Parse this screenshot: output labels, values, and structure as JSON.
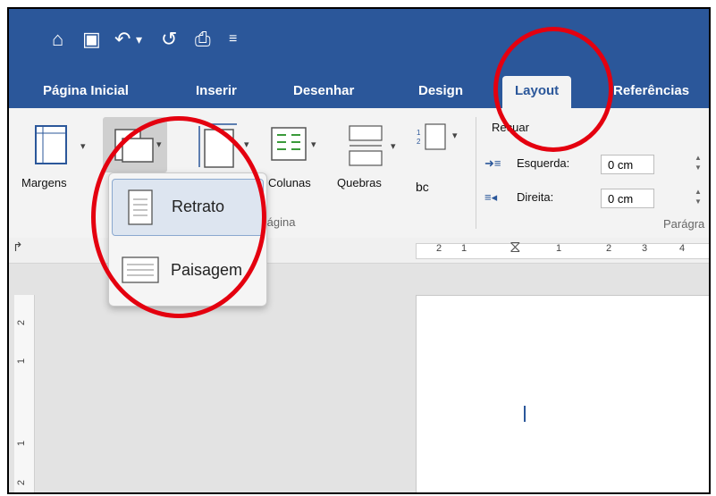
{
  "tabs": [
    "Página Inicial",
    "Inserir",
    "Desenhar",
    "Design",
    "Layout",
    "Referências"
  ],
  "active_tab": "Layout",
  "ribbon": {
    "margens_label": "Margens",
    "colunas_label": "Colunas",
    "quebras_label": "Quebras",
    "hyphen_label": "bc",
    "recuar_label": "Recuar",
    "esquerda_label": "Esquerda:",
    "direita_label": "Direita:",
    "esquerda_value": "0 cm",
    "direita_value": "0 cm",
    "pagina_group": "Página",
    "paragrafo_group": "Parágra"
  },
  "orientation_menu": {
    "items": [
      "Retrato",
      "Paisagem"
    ],
    "selected": "Retrato"
  },
  "ruler": {
    "h_ticks": [
      "2",
      "1",
      "1",
      "2",
      "3",
      "4"
    ],
    "v_ticks": [
      "2",
      "1",
      "1",
      "2"
    ]
  },
  "colors": {
    "accent": "#2b579a",
    "annotation": "#e4000f"
  }
}
